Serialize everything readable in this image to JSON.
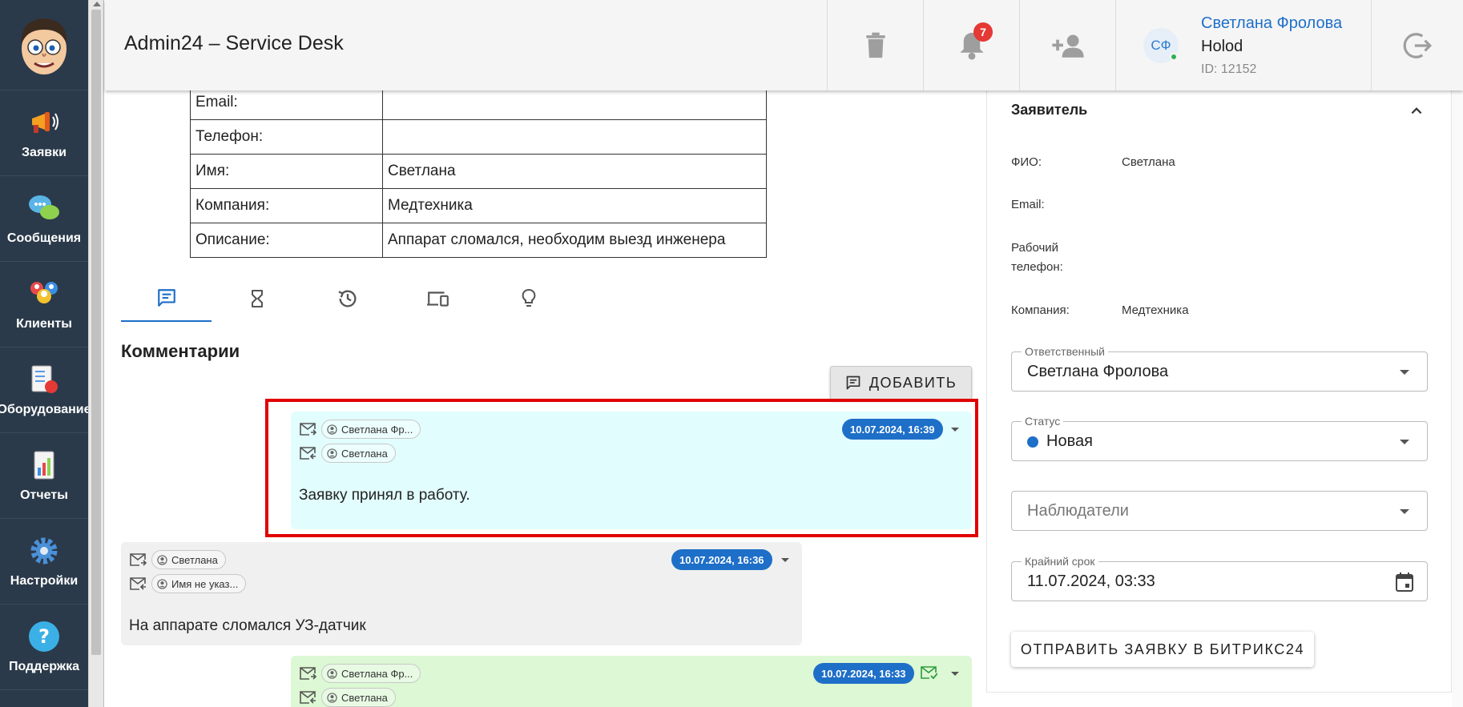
{
  "app": {
    "title": "Admin24 – Service Desk"
  },
  "sidebar": {
    "items": [
      {
        "label": "Заявки",
        "icon": "megaphone-icon"
      },
      {
        "label": "Сообщения",
        "icon": "chat-bubbles-icon"
      },
      {
        "label": "Клиенты",
        "icon": "users-icon"
      },
      {
        "label": "Оборудование",
        "icon": "equipment-icon"
      },
      {
        "label": "Отчеты",
        "icon": "report-icon"
      },
      {
        "label": "Настройки",
        "icon": "gear-icon"
      },
      {
        "label": "Поддержка",
        "icon": "help-icon"
      }
    ]
  },
  "header": {
    "notifications_count": "7",
    "user": {
      "initials": "СФ",
      "name": "Светлана Фролова",
      "org": "Holod",
      "id": "ID: 12152"
    }
  },
  "ticket_info": [
    {
      "key": "Email:",
      "value": ""
    },
    {
      "key": "Телефон:",
      "value": ""
    },
    {
      "key": "Имя:",
      "value": "Светлана"
    },
    {
      "key": "Компания:",
      "value": "Медтехника"
    },
    {
      "key": "Описание:",
      "value": "Аппарат сломался, необходим выезд инженера"
    }
  ],
  "comments_section": {
    "title": "Комментарии",
    "add_label": "ДОБАВИТЬ",
    "comments": [
      {
        "from": "Светлана Фр...",
        "to": "Светлана",
        "timestamp": "10.07.2024, 16:39",
        "text": "Заявку принял в работу.",
        "bg": "#e2fdfd"
      },
      {
        "from": "Светлана",
        "to": "Имя не указ...",
        "timestamp": "10.07.2024, 16:36",
        "text": "На аппарате сломался УЗ-датчик",
        "bg": "#f0f0f0"
      },
      {
        "from": "Светлана Фр...",
        "to": "Светлана",
        "timestamp": "10.07.2024, 16:33",
        "text": "",
        "bg": "#dcf8d4"
      }
    ]
  },
  "panel": {
    "title": "Заявитель",
    "fio_label": "ФИО:",
    "fio_value": "Светлана",
    "email_label": "Email:",
    "email_value": "",
    "phone_label_1": "Рабочий",
    "phone_label_2": "телефон:",
    "phone_value": "",
    "company_label": "Компания:",
    "company_value": "Медтехника",
    "responsible_label": "Ответственный",
    "responsible_value": "Светлана Фролова",
    "status_label": "Статус",
    "status_value": "Новая",
    "watchers_placeholder": "Наблюдатели",
    "deadline_label": "Крайний срок",
    "deadline_value": "11.07.2024, 03:33",
    "send_button": "ОТПРАВИТЬ ЗАЯВКУ В БИТРИКС24"
  },
  "colors": {
    "accent": "#1e6fc8",
    "sidebar_bg": "#2b3a4a",
    "badge": "#e53935",
    "highlight": "#e00000"
  }
}
